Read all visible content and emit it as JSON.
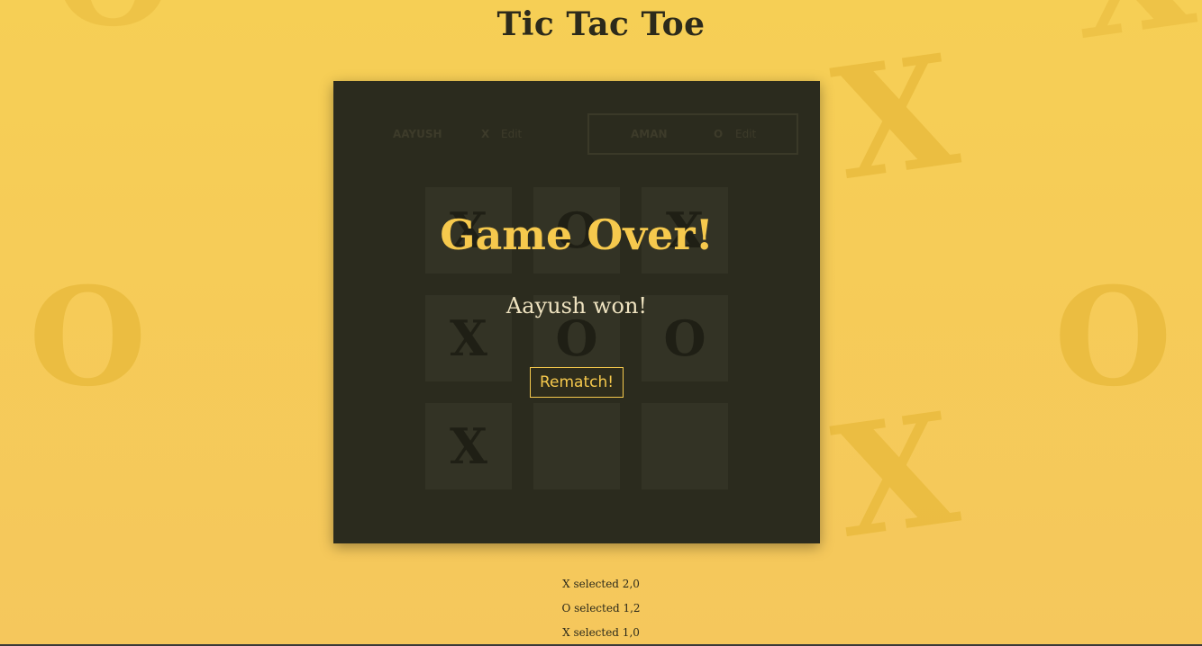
{
  "app": {
    "title": "Tic Tac Toe"
  },
  "background_marks": [
    "X",
    "O",
    "O",
    "X",
    "O",
    "X"
  ],
  "players": [
    {
      "name": "AAYUSH",
      "symbol": "X",
      "edit_label": "Edit",
      "active": false
    },
    {
      "name": "AMAN",
      "symbol": "O",
      "edit_label": "Edit",
      "active": true
    }
  ],
  "board": {
    "cells": [
      "X",
      "O",
      "X",
      "X",
      "O",
      "O",
      "X",
      "",
      ""
    ]
  },
  "game_over": {
    "title": "Game Over!",
    "message": "Aayush won!",
    "rematch_label": "Rematch!"
  },
  "log": [
    "X selected 2,0",
    "O selected 1,2",
    "X selected 1,0"
  ],
  "colors": {
    "background": "#f6cf55",
    "panel": "#2b2b1e",
    "accent": "#f6c94d",
    "title": "#2c2a1b"
  }
}
